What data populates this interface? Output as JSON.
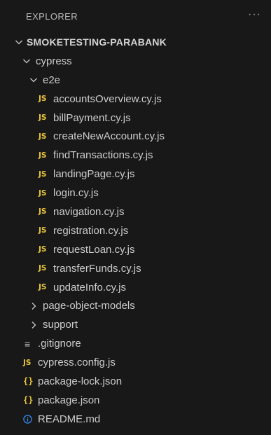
{
  "explorer": {
    "title": "EXPLORER",
    "more_actions": "···"
  },
  "colors": {
    "background": "#181818",
    "js_icon": "#e8c33b",
    "json_icon": "#e8c33b",
    "info_icon": "#3794ff",
    "text": "#cccccc"
  },
  "tree": {
    "root": "SMOKETESTING-PARABANK",
    "cypress_folder": "cypress",
    "e2e_folder": "e2e",
    "e2e_files": [
      "accountsOverview.cy.js",
      "billPayment.cy.js",
      "createNewAccount.cy.js",
      "findTransactions.cy.js",
      "landingPage.cy.js",
      "login.cy.js",
      "navigation.cy.js",
      "registration.cy.js",
      "requestLoan.cy.js",
      "transferFunds.cy.js",
      "updateInfo.cy.js"
    ],
    "page_object_models_folder": "page-object-models",
    "support_folder": "support",
    "gitignore_file": ".gitignore",
    "cypress_config_file": "cypress.config.js",
    "package_lock_file": "package-lock.json",
    "package_file": "package.json",
    "readme_file": "README.md"
  },
  "icons": {
    "js_label": "JS",
    "json_label": "{}",
    "gitignore_label": "≡",
    "expanded": "chevron-down-icon",
    "collapsed": "chevron-right-icon",
    "readme": "info-icon"
  }
}
